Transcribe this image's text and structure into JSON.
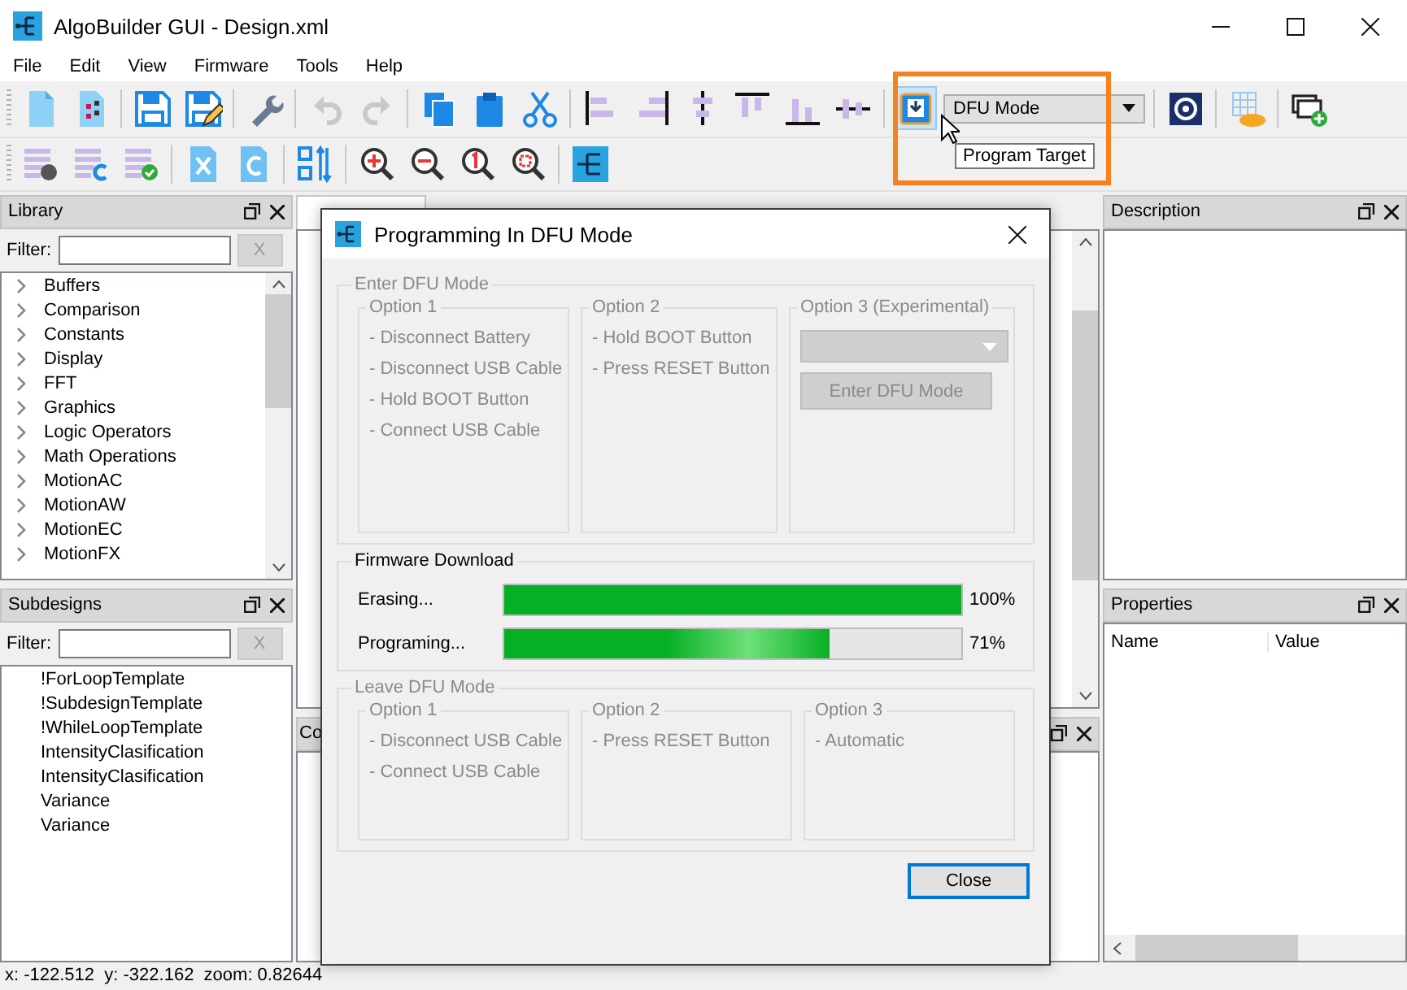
{
  "window": {
    "title": "AlgoBuilder GUI - Design.xml"
  },
  "menu": [
    "File",
    "Edit",
    "View",
    "Firmware",
    "Tools",
    "Help"
  ],
  "toolbar_top": [
    {
      "kind": "new-file",
      "selected": false,
      "disabled": false
    },
    {
      "kind": "new-design",
      "selected": false,
      "disabled": false
    },
    {
      "kind": "sep"
    },
    {
      "kind": "save",
      "selected": false,
      "disabled": false
    },
    {
      "kind": "save-as",
      "selected": false,
      "disabled": false
    },
    {
      "kind": "sep"
    },
    {
      "kind": "wrench",
      "selected": false,
      "disabled": false
    },
    {
      "kind": "sep"
    },
    {
      "kind": "undo",
      "selected": false,
      "disabled": true
    },
    {
      "kind": "redo",
      "selected": false,
      "disabled": true
    },
    {
      "kind": "sep"
    },
    {
      "kind": "copy",
      "selected": false,
      "disabled": false
    },
    {
      "kind": "paste",
      "selected": false,
      "disabled": false
    },
    {
      "kind": "cut",
      "selected": false,
      "disabled": false
    },
    {
      "kind": "sep"
    },
    {
      "kind": "align-left",
      "selected": false,
      "disabled": false
    },
    {
      "kind": "align-right",
      "selected": false,
      "disabled": false
    },
    {
      "kind": "align-center",
      "selected": false,
      "disabled": false
    },
    {
      "kind": "align-top",
      "selected": false,
      "disabled": false
    },
    {
      "kind": "align-bottom",
      "selected": false,
      "disabled": false
    },
    {
      "kind": "align-middle",
      "selected": false,
      "disabled": false
    },
    {
      "kind": "sep"
    },
    {
      "kind": "program",
      "selected": true,
      "disabled": false
    },
    {
      "kind": "select",
      "value": "DFU Mode"
    },
    {
      "kind": "sep"
    },
    {
      "kind": "board",
      "selected": false,
      "disabled": false
    },
    {
      "kind": "sep"
    },
    {
      "kind": "grid-cloud",
      "selected": false,
      "disabled": false
    },
    {
      "kind": "sep"
    },
    {
      "kind": "add-window",
      "selected": false,
      "disabled": false
    }
  ],
  "toolbar_bottom": [
    {
      "kind": "list-gear",
      "selected": false,
      "disabled": false
    },
    {
      "kind": "list-c",
      "selected": false,
      "disabled": false
    },
    {
      "kind": "list-check",
      "selected": false,
      "disabled": false
    },
    {
      "kind": "sep"
    },
    {
      "kind": "x-file",
      "selected": false,
      "disabled": false
    },
    {
      "kind": "c-file",
      "selected": false,
      "disabled": false
    },
    {
      "kind": "sep"
    },
    {
      "kind": "sort",
      "selected": false,
      "disabled": false
    },
    {
      "kind": "sep"
    },
    {
      "kind": "zoom-in",
      "selected": false,
      "disabled": false
    },
    {
      "kind": "zoom-out",
      "selected": false,
      "disabled": false
    },
    {
      "kind": "zoom-one",
      "selected": false,
      "disabled": false
    },
    {
      "kind": "zoom-fit",
      "selected": false,
      "disabled": false
    },
    {
      "kind": "sep"
    },
    {
      "kind": "flow",
      "selected": false,
      "disabled": false
    }
  ],
  "tooltip": "Program Target",
  "library": {
    "title": "Library",
    "filter_label": "Filter:",
    "clear_button": "X",
    "items": [
      {
        "label": "Buffers",
        "expanded": false
      },
      {
        "label": "Comparison",
        "expanded": false
      },
      {
        "label": "Constants",
        "expanded": false
      },
      {
        "label": "Display",
        "expanded": false
      },
      {
        "label": "FFT",
        "expanded": false
      },
      {
        "label": "Graphics",
        "expanded": false
      },
      {
        "label": "Logic Operators",
        "expanded": false
      },
      {
        "label": "Math Operations",
        "expanded": false
      },
      {
        "label": "MotionAC",
        "expanded": false
      },
      {
        "label": "MotionAW",
        "expanded": false
      },
      {
        "label": "MotionEC",
        "expanded": false
      },
      {
        "label": "MotionFX",
        "expanded": false
      }
    ]
  },
  "subdesigns": {
    "title": "Subdesigns",
    "filter_label": "Filter:",
    "clear_button": "X",
    "items": [
      "!ForLoopTemplate",
      "!SubdesignTemplate",
      "!WhileLoopTemplate",
      "IntensityClasification",
      "IntensityClasification",
      "Variance",
      "Variance"
    ]
  },
  "center_bottom_dock": {
    "title": "Co"
  },
  "description": {
    "title": "Description"
  },
  "properties": {
    "title": "Properties",
    "columns": [
      "Name",
      "Value"
    ]
  },
  "status_bar": "x: -122.512  y: -322.162  zoom: 0.82644",
  "dialog": {
    "title": "Programming In DFU Mode",
    "groups": [
      {
        "kind": "options",
        "title": "Enter DFU Mode",
        "disabled": true,
        "options": [
          {
            "kind": "steps",
            "title": "Option 1",
            "steps": [
              "- Disconnect Battery",
              "- Disconnect USB Cable",
              "- Hold BOOT Button",
              "- Connect USB Cable"
            ]
          },
          {
            "kind": "steps",
            "title": "Option 2",
            "steps": [
              "- Hold BOOT Button",
              "- Press RESET Button"
            ]
          },
          {
            "kind": "action",
            "title": "Option 3 (Experimental)",
            "button": "Enter DFU Mode"
          }
        ]
      },
      {
        "kind": "progress",
        "title": "Firmware Download",
        "disabled": false,
        "rows": [
          {
            "label": "Erasing...",
            "level": 1.0,
            "reading": "100%"
          },
          {
            "label": "Programing...",
            "level": 0.71,
            "reading": "71%"
          }
        ]
      },
      {
        "kind": "options",
        "title": "Leave DFU Mode",
        "disabled": true,
        "options": [
          {
            "kind": "steps",
            "title": "Option 1",
            "steps": [
              "- Disconnect USB Cable",
              "- Connect USB Cable"
            ]
          },
          {
            "kind": "steps",
            "title": "Option 2",
            "steps": [
              "- Press RESET Button"
            ]
          },
          {
            "kind": "steps",
            "title": "Option 3",
            "steps": [
              "- Automatic"
            ]
          }
        ]
      }
    ],
    "close_button": "Close"
  }
}
